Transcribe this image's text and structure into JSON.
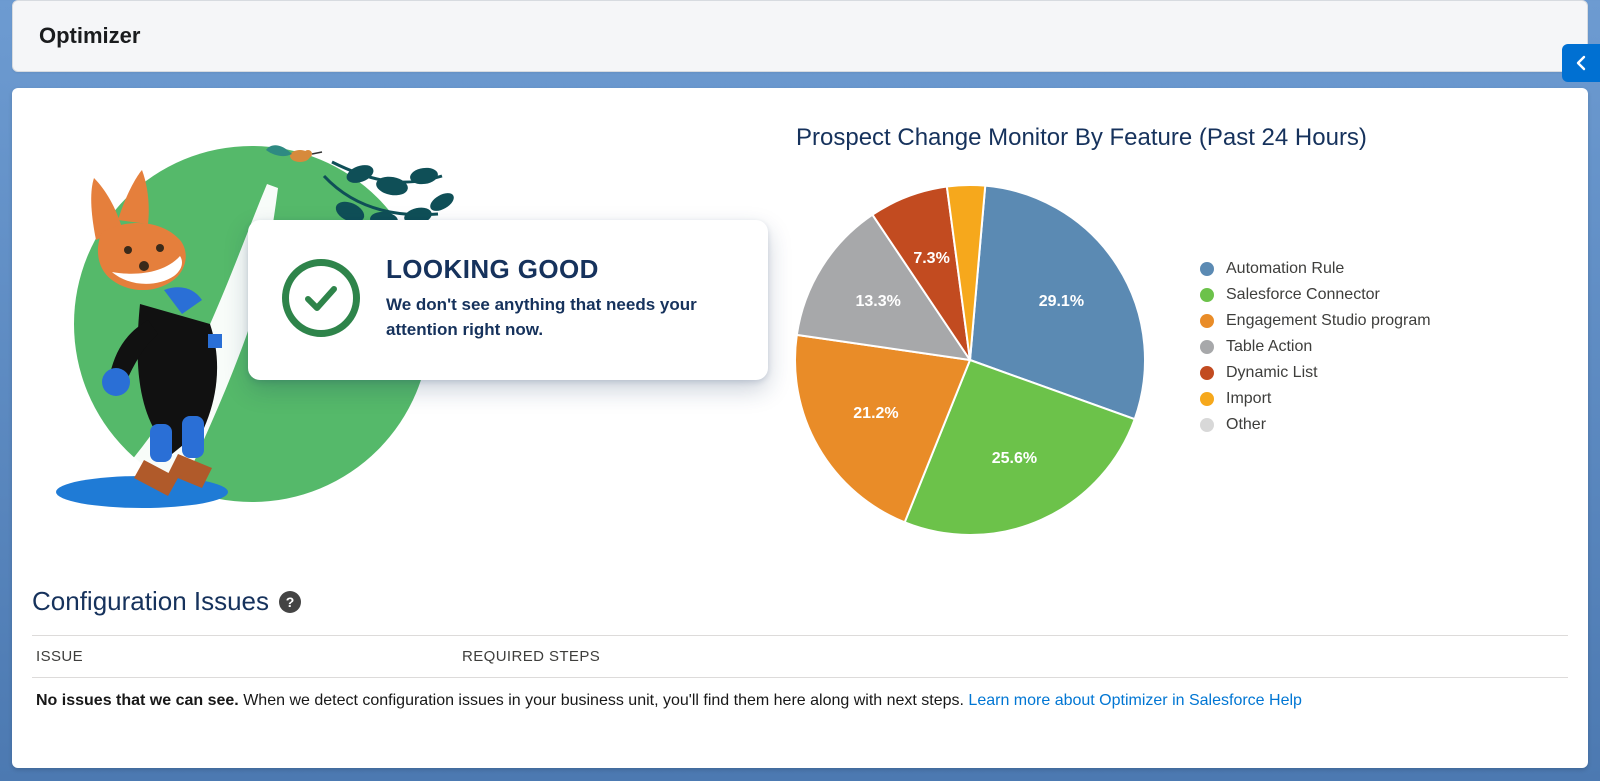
{
  "header": {
    "title": "Optimizer"
  },
  "status": {
    "title": "LOOKING GOOD",
    "body": "We don't see anything that needs your attention right now."
  },
  "chart_data": {
    "type": "pie",
    "title": "Prospect Change Monitor By Feature (Past 24 Hours)",
    "series": [
      {
        "name": "Automation Rule",
        "value": 29.1,
        "label": "29.1%",
        "color": "#5b8ab3"
      },
      {
        "name": "Salesforce Connector",
        "value": 25.6,
        "label": "25.6%",
        "color": "#6cc24a"
      },
      {
        "name": "Engagement Studio program",
        "value": 21.2,
        "label": "21.2%",
        "color": "#e98c28"
      },
      {
        "name": "Table Action",
        "value": 13.3,
        "label": "13.3%",
        "color": "#a7a8aa"
      },
      {
        "name": "Dynamic List",
        "value": 7.3,
        "label": "7.3%",
        "color": "#c24b20"
      },
      {
        "name": "Import",
        "value": 3.5,
        "label": "",
        "color": "#f6a81c"
      },
      {
        "name": "Other",
        "value": 0.0,
        "label": "",
        "color": "#d8d8d8"
      }
    ],
    "start_angle_deg": 5
  },
  "config_issues": {
    "heading": "Configuration Issues",
    "columns": {
      "issue": "ISSUE",
      "steps": "REQUIRED STEPS"
    },
    "empty_bold": "No issues that we can see.",
    "empty_rest": " When we detect configuration issues in your business unit, you'll find them here along with next steps. ",
    "help_link_text": "Learn more about Optimizer in Salesforce Help"
  }
}
